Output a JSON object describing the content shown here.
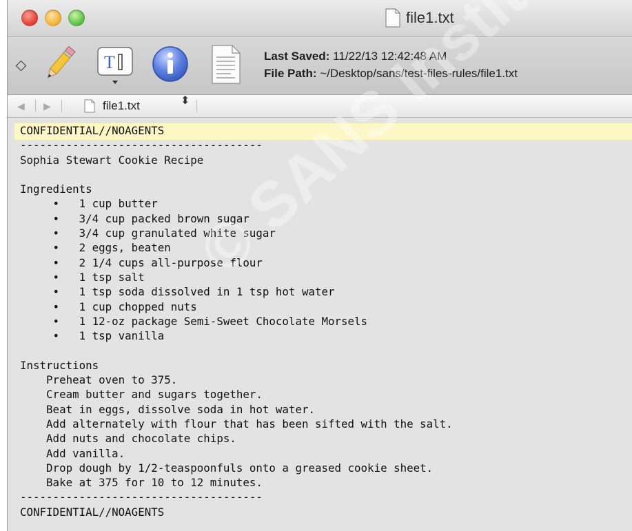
{
  "window": {
    "title": "file1.txt"
  },
  "toolbar": {
    "icons": [
      "diamond-icon",
      "pencil-icon",
      "text-format-icon",
      "info-icon",
      "document-icon"
    ],
    "last_saved_label": "Last Saved:",
    "last_saved_value": "11/22/13 12:42:48 AM",
    "file_path_label": "File Path:",
    "file_path_value": "~/Desktop/sans/test-files-rules/file1.txt"
  },
  "navbar": {
    "back_arrow": "◀",
    "forward_arrow": "▶",
    "file_name": "file1.txt",
    "updown": "⬍"
  },
  "document": {
    "lines": [
      "CONFIDENTIAL//NOAGENTS",
      "-------------------------------------",
      "Sophia Stewart Cookie Recipe",
      "",
      "Ingredients",
      "     •   1 cup butter",
      "     •   3/4 cup packed brown sugar",
      "     •   3/4 cup granulated white sugar",
      "     •   2 eggs, beaten",
      "     •   2 1/4 cups all-purpose flour",
      "     •   1 tsp salt",
      "     •   1 tsp soda dissolved in 1 tsp hot water",
      "     •   1 cup chopped nuts",
      "     •   1 12-oz package Semi-Sweet Chocolate Morsels",
      "     •   1 tsp vanilla",
      "",
      "Instructions",
      "    Preheat oven to 375.",
      "    Cream butter and sugars together.",
      "    Beat in eggs, dissolve soda in hot water.",
      "    Add alternately with flour that has been sifted with the salt.",
      "    Add nuts and chocolate chips.",
      "    Add vanilla.",
      "    Drop dough by 1/2-teaspoonfuls onto a greased cookie sheet.",
      "    Bake at 375 for 10 to 12 minutes.",
      "-------------------------------------",
      "CONFIDENTIAL//NOAGENTS"
    ]
  },
  "watermark": {
    "text": "© SANS Institute, Author retains full rights."
  }
}
